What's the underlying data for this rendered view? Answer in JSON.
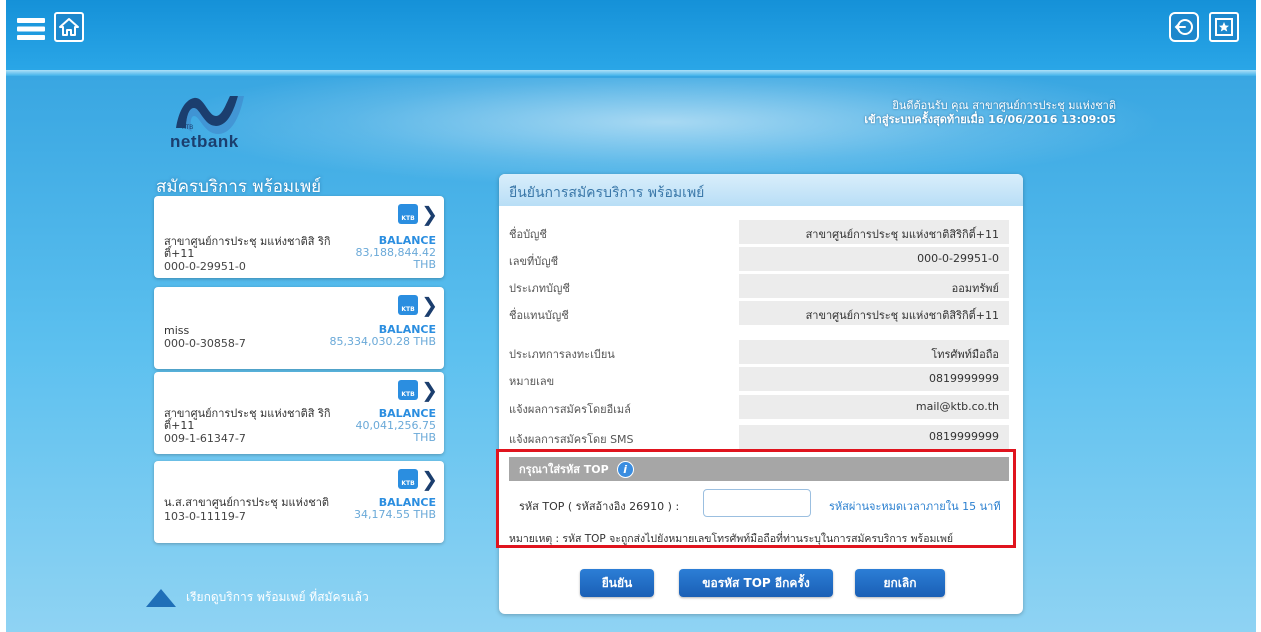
{
  "header": {
    "icons": [
      "menu-icon",
      "home-icon",
      "logout-icon",
      "favorite-icon"
    ],
    "logo_text": "netbank",
    "logo_small": "KTB",
    "welcome_line1": "ยินดีต้อนรับ คุณ สาขาศูนย์การประชุ มแห่งชาติ",
    "welcome_line2": "เข้าสู่ระบบครั้งสุดท้ายเมื่อ 16/06/2016 13:09:05"
  },
  "sidebar": {
    "title": "สมัครบริการ พร้อมเพย์",
    "accounts": [
      {
        "name": "สาขาศูนย์การประชุ มแห่งชาติสิ ริกิติ์+11",
        "number": "000-0-29951-0",
        "balance_label": "BALANCE",
        "balance": "83,188,844.42",
        "currency": "THB"
      },
      {
        "name": "miss",
        "number": "000-0-30858-7",
        "balance_label": "BALANCE",
        "balance": "85,334,030.28 THB",
        "currency": ""
      },
      {
        "name": "สาขาศูนย์การประชุ มแห่งชาติสิ ริกิติ์+11",
        "number": "009-1-61347-7",
        "balance_label": "BALANCE",
        "balance": "40,041,256.75",
        "currency": "THB"
      },
      {
        "name": "น.ส.สาขาศูนย์การประชุ มแห่งชาติ",
        "number": "103-0-11119-7",
        "balance_label": "BALANCE",
        "balance": "34,174.55 THB",
        "currency": ""
      }
    ],
    "bank_badge": "KTB",
    "back_link": "เรียกดูบริการ พร้อมเพย์ ที่สมัครแล้ว"
  },
  "panel": {
    "title": "ยืนยันการสมัครบริการ พร้อมเพย์",
    "rows": [
      {
        "label": "ชื่อบัญชี",
        "value": "สาขาศูนย์การประชุ มแห่งชาติสิริกิติ์+11"
      },
      {
        "label": "เลขที่บัญชี",
        "value": "000-0-29951-0"
      },
      {
        "label": "ประเภทบัญชี",
        "value": "ออมทรัพย์"
      },
      {
        "label": "ชื่อแทนบัญชี",
        "value": "สาขาศูนย์การประชุ มแห่งชาติสิริกิติ์+11"
      },
      {
        "label": "ประเภทการลงทะเบียน",
        "value": "โทรศัพท์มือถือ"
      },
      {
        "label": "หมายเลข",
        "value": "0819999999"
      },
      {
        "label": "แจ้งผลการสมัครโดยอีเมล์",
        "value": "mail@ktb.co.th"
      },
      {
        "label": "แจ้งผลการสมัครโดย SMS",
        "value": "0819999999"
      }
    ],
    "top": {
      "header": "กรุณาใส่รหัส TOP",
      "info_glyph": "i",
      "label": "รหัส TOP ( รหัสอ้างอิง 26910 ) :",
      "input_value": "",
      "timeout": "รหัสผ่านจะหมดเวลาภายใน 15 นาที",
      "note": "หมายเหตุ : รหัส TOP จะถูกส่งไปยังหมายเลขโทรศัพท์มือถือที่ท่านระบุในการสมัครบริการ พร้อมเพย์"
    },
    "buttons": {
      "confirm": "ยืนยัน",
      "resend": "ขอรหัส TOP อีกครั้ง",
      "cancel": "ยกเลิก"
    }
  },
  "colors": {
    "accent": "#1a5fb5",
    "highlight": "#e0141e",
    "background": "#5cc0ef"
  }
}
